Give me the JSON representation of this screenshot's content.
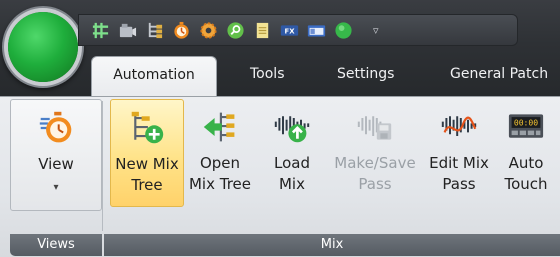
{
  "quick_access_toolbar": {
    "icons": [
      "grid-icon",
      "camera-icon",
      "mix-tree-icon",
      "timer-icon",
      "gear-icon",
      "search-icon",
      "notes-icon",
      "fx-icon",
      "window-icon",
      "green-orb-icon"
    ],
    "dropdown_glyph": "▿"
  },
  "tabs": [
    "Automation",
    "Tools",
    "Settings",
    "General Patch"
  ],
  "active_tab": "Automation",
  "groups": {
    "views": {
      "label": "Views",
      "buttons": [
        {
          "label": "View",
          "icon": "stopwatch-icon",
          "dropdown": "▾"
        }
      ]
    },
    "mix": {
      "label": "Mix",
      "buttons": [
        {
          "label": "New Mix\nTree",
          "icon": "new-mix-tree-icon",
          "highlighted": true
        },
        {
          "label": "Open\nMix Tree",
          "icon": "open-mix-tree-icon"
        },
        {
          "label": "Load\nMix",
          "icon": "load-mix-icon"
        },
        {
          "label": "Make/Save\nPass",
          "icon": "make-save-pass-icon",
          "disabled": true
        },
        {
          "label": "Edit Mix\nPass",
          "icon": "edit-mix-pass-icon"
        },
        {
          "label": "Auto\nTouch",
          "icon": "auto-touch-icon"
        }
      ]
    }
  },
  "colors": {
    "orb": "#1fae3c",
    "titlebar": "#2e3135",
    "ribbon": "#e2e5e9",
    "highlight": "#ffe389",
    "group_label_bg": "#5f656c"
  }
}
